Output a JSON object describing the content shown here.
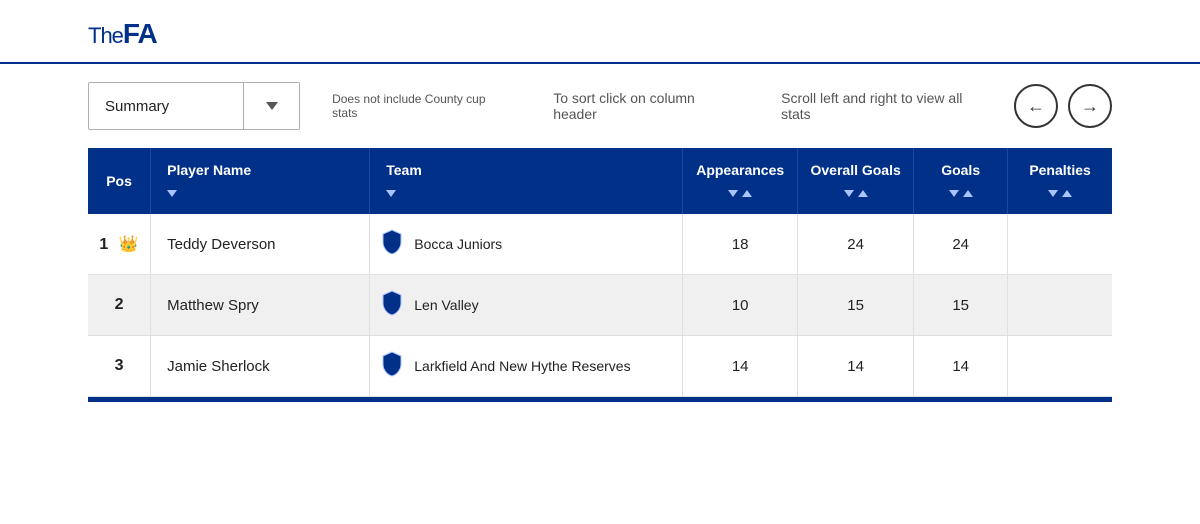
{
  "logo": {
    "the": "The",
    "fa": "FA"
  },
  "dropdown": {
    "label": "Summary",
    "aria": "Summary dropdown"
  },
  "hints": {
    "county_cup": "Does not include County cup stats",
    "sort": "To sort click on column header",
    "scroll": "Scroll left and right to view all stats"
  },
  "nav": {
    "prev_label": "←",
    "next_label": "→"
  },
  "table": {
    "columns": [
      {
        "key": "pos",
        "label": "Pos",
        "sortable": false
      },
      {
        "key": "player_name",
        "label": "Player Name",
        "sortable": true,
        "sort_type": "single"
      },
      {
        "key": "team",
        "label": "Team",
        "sortable": true,
        "sort_type": "single"
      },
      {
        "key": "appearances",
        "label": "Appearances",
        "sortable": true,
        "sort_type": "both"
      },
      {
        "key": "overall_goals",
        "label": "Overall Goals",
        "sortable": true,
        "sort_type": "both"
      },
      {
        "key": "goals",
        "label": "Goals",
        "sortable": true,
        "sort_type": "both"
      },
      {
        "key": "penalties",
        "label": "Penalties",
        "sortable": true,
        "sort_type": "both"
      }
    ],
    "rows": [
      {
        "pos": "1",
        "crown": true,
        "player_name": "Teddy Deverson",
        "team": "Bocca Juniors",
        "appearances": "18",
        "overall_goals": "24",
        "goals": "24",
        "penalties": ""
      },
      {
        "pos": "2",
        "crown": false,
        "player_name": "Matthew Spry",
        "team": "Len Valley",
        "appearances": "10",
        "overall_goals": "15",
        "goals": "15",
        "penalties": ""
      },
      {
        "pos": "3",
        "crown": false,
        "player_name": "Jamie Sherlock",
        "team": "Larkfield And New Hythe Reserves",
        "appearances": "14",
        "overall_goals": "14",
        "goals": "14",
        "penalties": ""
      }
    ]
  }
}
